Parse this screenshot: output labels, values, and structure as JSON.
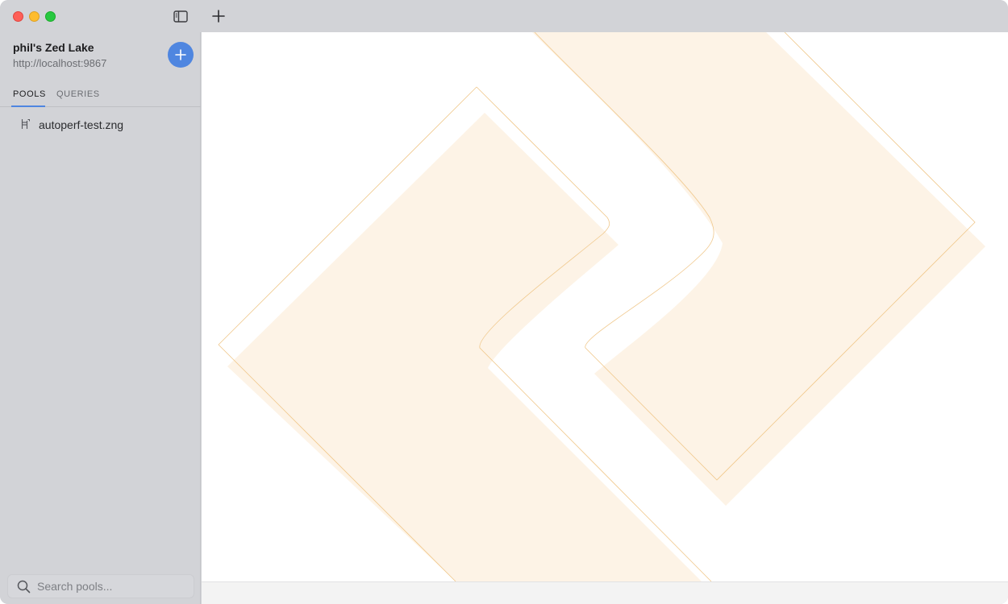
{
  "lake": {
    "name": "phil's Zed Lake",
    "url": "http://localhost:9867"
  },
  "tabs": [
    {
      "label": "POOLS",
      "active": true
    },
    {
      "label": "QUERIES",
      "active": false
    }
  ],
  "pools": [
    {
      "name": "autoperf-test.zng",
      "icon": "pool-icon"
    }
  ],
  "search": {
    "placeholder": "Search pools...",
    "value": ""
  },
  "colors": {
    "accent": "#4f86e0",
    "sidebar": "#d2d3d7",
    "watermark_fill": "#fdf3e6",
    "watermark_stroke": "#f0c88c"
  },
  "icons": {
    "sidebar_toggle": "sidebar-toggle-icon",
    "new_tab": "plus-icon",
    "add": "plus-icon",
    "search": "search-icon",
    "pool": "pool-icon"
  }
}
